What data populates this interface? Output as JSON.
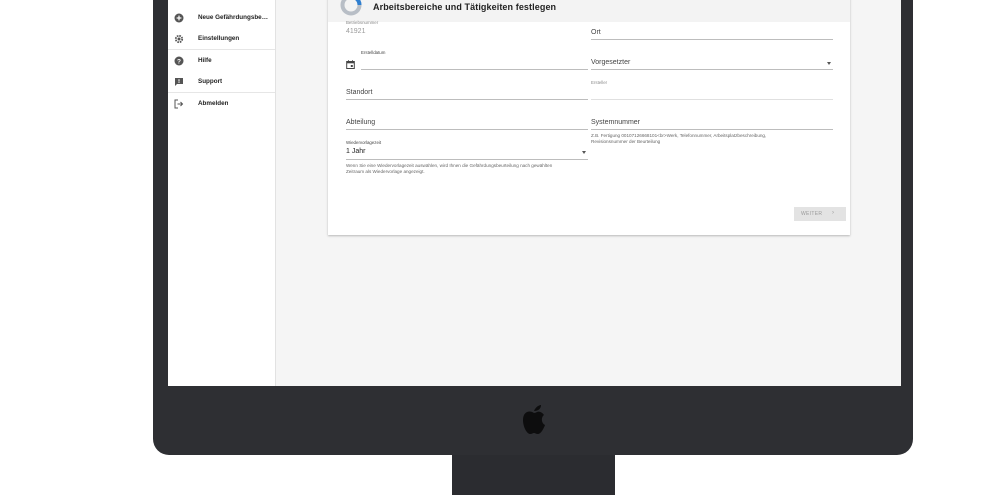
{
  "sidebar": {
    "items": [
      {
        "label": "Neue Gefährdungsbeurt...",
        "icon": "add-circle-icon"
      },
      {
        "label": "Einstellungen",
        "icon": "gear-icon"
      },
      {
        "label": "Hilfe",
        "icon": "help-icon"
      },
      {
        "label": "Support",
        "icon": "feedback-icon"
      },
      {
        "label": "Abmelden",
        "icon": "logout-icon"
      }
    ]
  },
  "card": {
    "title": "Arbeitsbereiche und Tätigkeiten festlegen"
  },
  "form": {
    "betriebsnummer": {
      "label": "Betriebsnummer",
      "value": "41921"
    },
    "ort": {
      "label": "Ort",
      "value": ""
    },
    "erstelldatum": {
      "label": "Erstelldatum",
      "value": "",
      "icon": "calendar-icon"
    },
    "vorgesetzter": {
      "label": "Vorgesetzter",
      "value": ""
    },
    "standort": {
      "label": "Standort",
      "value": ""
    },
    "ersteller": {
      "label": "Ersteller",
      "value": ""
    },
    "abteilung": {
      "label": "Abteilung",
      "value": ""
    },
    "systemnummer": {
      "label": "Systemnummer",
      "value": "",
      "hint_line1": "Z.B. Fertigung 00107126668101<br>Werk, Telefonnummer, Arbeitsplatzbeschreibung,",
      "hint_line2": "Revisionsnummer der Beurteilung"
    },
    "wiedervorlagezeit": {
      "label": "Wiedervorlagezeit",
      "value": "1 Jahr",
      "hint_line1": "Wenn Sie eine Wiedervorlagezeit auswählen, wird Ihnen die Gefährdungsbeurteilung nach gewählten",
      "hint_line2": "Zeitraum als Wiedervorlage angezeigt."
    }
  },
  "actions": {
    "next_label": "WEITER",
    "next_icon": "chevron-right-icon"
  },
  "colors": {
    "accent_blue": "#2f7fd0",
    "frame": "#2e2f33"
  }
}
